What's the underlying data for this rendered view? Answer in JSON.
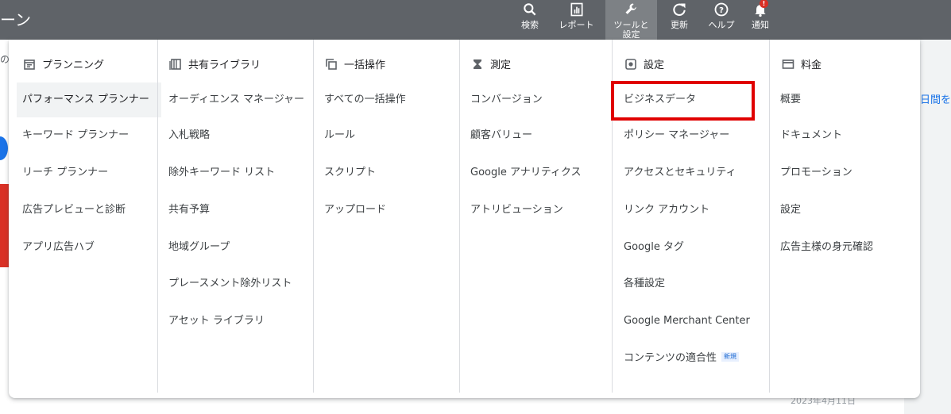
{
  "header": {
    "title_fragment": "ーン",
    "tools": [
      {
        "label": "検索",
        "icon": "search-icon"
      },
      {
        "label": "レポート",
        "icon": "report-icon"
      },
      {
        "label": "ツールと\n設定",
        "label_line1": "ツールと",
        "label_line2": "設定",
        "icon": "wrench-icon"
      },
      {
        "label": "更新",
        "icon": "refresh-icon"
      },
      {
        "label": "ヘルプ",
        "icon": "help-icon"
      },
      {
        "label": "通知",
        "icon": "bell-icon",
        "badge": "!"
      }
    ]
  },
  "background": {
    "top_left_fragment": "の",
    "right_link_fragment": "日間を",
    "date_fragment": "2023年4月11日"
  },
  "menu": {
    "columns": [
      {
        "heading": "プランニング",
        "icon": "calendar-icon",
        "items": [
          "パフォーマンス プランナー",
          "キーワード プランナー",
          "リーチ プランナー",
          "広告プレビューと診断",
          "アプリ広告ハブ"
        ],
        "selected_index": 0
      },
      {
        "heading": "共有ライブラリ",
        "icon": "library-icon",
        "items": [
          "オーディエンス マネージャー",
          "入札戦略",
          "除外キーワード リスト",
          "共有予算",
          "地域グループ",
          "プレースメント除外リスト",
          "アセット ライブラリ"
        ]
      },
      {
        "heading": "一括操作",
        "icon": "copy-icon",
        "items": [
          "すべての一括操作",
          "ルール",
          "スクリプト",
          "アップロード"
        ]
      },
      {
        "heading": "測定",
        "icon": "hourglass-icon",
        "items": [
          "コンバージョン",
          "顧客バリュー",
          "Google アナリティクス",
          "アトリビューション"
        ]
      },
      {
        "heading": "設定",
        "icon": "settings-icon",
        "items": [
          "ビジネスデータ",
          "ポリシー マネージャー",
          "アクセスとセキュリティ",
          "リンク アカウント",
          "Google タグ",
          "各種設定",
          "Google Merchant Center",
          "コンテンツの適合性"
        ],
        "highlighted_index": 0,
        "new_badge_index": 7,
        "new_badge_label": "新規"
      },
      {
        "heading": "料金",
        "icon": "billing-icon",
        "items": [
          "概要",
          "ドキュメント",
          "プロモーション",
          "設定",
          "広告主様の身元確認"
        ]
      }
    ]
  },
  "colors": {
    "topbar": "#5f6368",
    "highlight": "#e00000",
    "link": "#1a73e8"
  }
}
